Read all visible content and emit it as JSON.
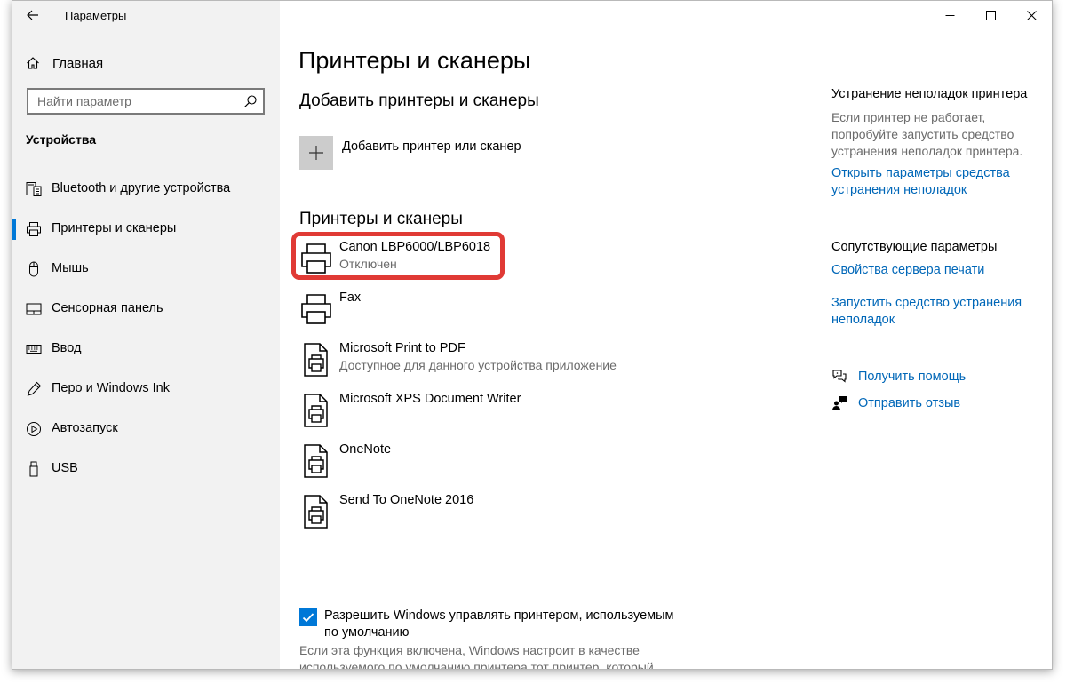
{
  "window": {
    "title": "Параметры",
    "controls": {
      "minimize": "—",
      "maximize": "☐",
      "close": "✕"
    }
  },
  "sidebar": {
    "home_label": "Главная",
    "search_placeholder": "Найти параметр",
    "section_heading": "Устройства",
    "items": [
      {
        "label": "Bluetooth и другие устройства",
        "icon": "bluetooth-devices-icon"
      },
      {
        "label": "Принтеры и сканеры",
        "icon": "printer-icon",
        "active": true
      },
      {
        "label": "Мышь",
        "icon": "mouse-icon"
      },
      {
        "label": "Сенсорная панель",
        "icon": "touchpad-icon"
      },
      {
        "label": "Ввод",
        "icon": "keyboard-icon"
      },
      {
        "label": "Перо и Windows Ink",
        "icon": "pen-icon"
      },
      {
        "label": "Автозапуск",
        "icon": "autoplay-icon"
      },
      {
        "label": "USB",
        "icon": "usb-icon"
      }
    ]
  },
  "main": {
    "page_title": "Принтеры и сканеры",
    "add_section_title": "Добавить принтеры и сканеры",
    "add_button_label": "Добавить принтер или сканер",
    "list_title": "Принтеры и сканеры",
    "printers": [
      {
        "name": "Canon LBP6000/LBP6018",
        "status": "Отключен",
        "icon": "printer-icon"
      },
      {
        "name": "Fax",
        "status": "",
        "icon": "printer-icon"
      },
      {
        "name": "Microsoft Print to PDF",
        "status": "Доступное для данного устройства приложение",
        "icon": "document-printer-icon"
      },
      {
        "name": "Microsoft XPS Document Writer",
        "status": "",
        "icon": "document-printer-icon"
      },
      {
        "name": "OneNote",
        "status": "",
        "icon": "document-printer-icon"
      },
      {
        "name": "Send To OneNote 2016",
        "status": "",
        "icon": "document-printer-icon"
      }
    ],
    "default_printer_checkbox": {
      "checked": true,
      "label": "Разрешить Windows управлять принтером, используемым по умолчанию",
      "description": "Если эта функция включена, Windows настроит в качестве используемого по умолчанию принтера тот принтер, который"
    },
    "highlight_color": "#e03a35"
  },
  "right_panel": {
    "troubleshoot_heading": "Устранение неполадок принтера",
    "troubleshoot_text": "Если принтер не работает, попробуйте запустить средство устранения неполадок принтера.",
    "troubleshoot_link": "Открыть параметры средства устранения неполадок",
    "related_heading": "Сопутствующие параметры",
    "print_server_link": "Свойства сервера печати",
    "run_troubleshooter_link": "Запустить средство устранения неполадок",
    "help_link": "Получить помощь",
    "feedback_link": "Отправить отзыв"
  },
  "colors": {
    "accent": "#0078d7",
    "link": "#0067b8",
    "sidebar_bg": "#f2f2f2"
  }
}
